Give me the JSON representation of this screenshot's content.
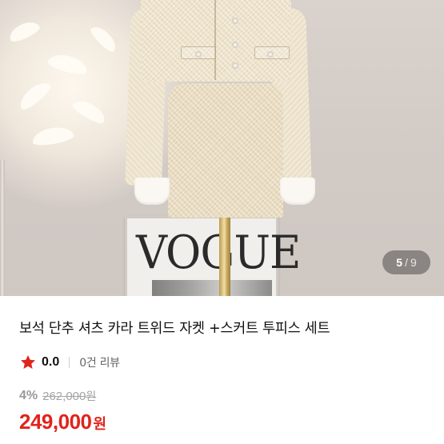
{
  "gallery": {
    "current": "5",
    "separator": "/",
    "total": "9",
    "poster_text": "VOGUE"
  },
  "product": {
    "title": "보석 단추 셔츠 카라 트위드 자켓 +스커트 투피스 세트",
    "rating": "0.0",
    "reviews": "0건 리뷰",
    "discount": "4%",
    "original_price": "262,000",
    "original_currency": "원",
    "price": "249,000",
    "currency": "원"
  },
  "colors": {
    "price": "#e0241c",
    "star": "#e0241c",
    "muted": "#9a9a9a"
  },
  "icons": {
    "rating": "star-icon"
  }
}
